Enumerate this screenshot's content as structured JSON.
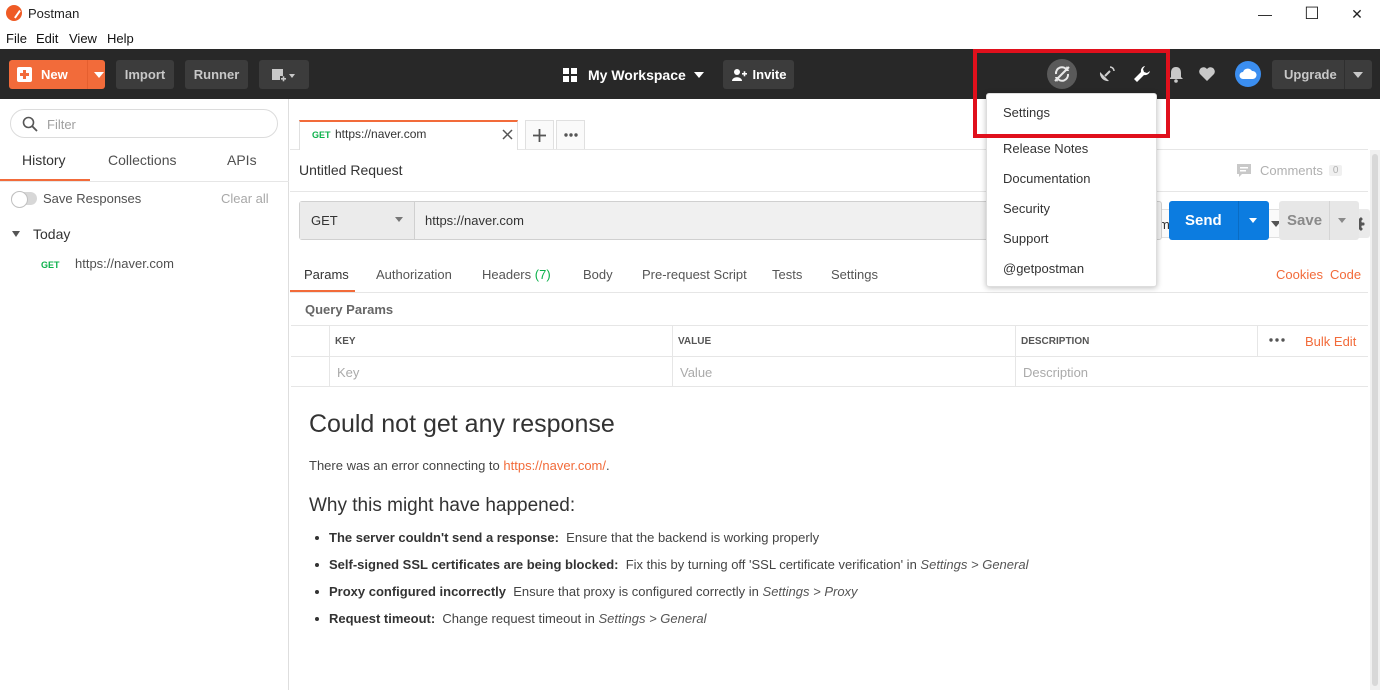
{
  "window": {
    "title": "Postman",
    "minimize": "—",
    "maximize": "☐",
    "close": "✕"
  },
  "menubar": [
    "File",
    "Edit",
    "View",
    "Help"
  ],
  "header": {
    "new_label": "New",
    "import_label": "Import",
    "runner_label": "Runner",
    "workspace_label": "My Workspace",
    "invite_label": "Invite",
    "upgrade_label": "Upgrade"
  },
  "sidebar": {
    "filter_placeholder": "Filter",
    "tabs": [
      "History",
      "Collections",
      "APIs"
    ],
    "active_tab": "History",
    "save_responses_label": "Save Responses",
    "clear_all_label": "Clear all",
    "group_label": "Today",
    "items": [
      {
        "method": "GET",
        "url": "https://naver.com"
      }
    ]
  },
  "request_tab": {
    "method": "GET",
    "url": "https://naver.com"
  },
  "request": {
    "name": "Untitled Request",
    "comments_label": "Comments",
    "comments_count": "0",
    "method": "GET",
    "url": "https://naver.com",
    "send_label": "Send",
    "save_label": "Save",
    "environment_fragment": "ment"
  },
  "request_tabs": {
    "params": "Params",
    "authorization": "Authorization",
    "headers": "Headers",
    "headers_count": "(7)",
    "body": "Body",
    "prerequest": "Pre-request Script",
    "tests": "Tests",
    "settings": "Settings",
    "cookies": "Cookies",
    "code": "Code"
  },
  "query_params": {
    "title": "Query Params",
    "columns": [
      "KEY",
      "VALUE",
      "DESCRIPTION"
    ],
    "placeholders": [
      "Key",
      "Value",
      "Description"
    ],
    "bulk_edit_label": "Bulk Edit"
  },
  "response": {
    "title": "Could not get any response",
    "error_prefix": "There was an error connecting to ",
    "error_link": "https://naver.com/",
    "error_suffix": ".",
    "why_title": "Why this might have happened:",
    "reasons": [
      {
        "bold": "The server couldn't send a response:",
        "text": "Ensure that the backend is working properly",
        "italic": ""
      },
      {
        "bold": "Self-signed SSL certificates are being blocked:",
        "text": "Fix this by turning off 'SSL certificate verification' in",
        "italic": "Settings > General"
      },
      {
        "bold": "Proxy configured incorrectly",
        "text": "Ensure that proxy is configured correctly in",
        "italic": "Settings > Proxy"
      },
      {
        "bold": "Request timeout:",
        "text": "Change request timeout in",
        "italic": "Settings > General"
      }
    ]
  },
  "settings_dropdown": {
    "items": [
      "Settings",
      "Release Notes",
      "Documentation",
      "Security",
      "Support",
      "@getpostman"
    ]
  },
  "colors": {
    "accent": "#f26b3a",
    "header_bg": "#282828",
    "send_blue": "#0c7ce0",
    "get_green": "#0cb14b",
    "highlight_red": "#e0101c"
  },
  "icons": {
    "sync": "sync-off-icon",
    "satellite": "satellite-icon",
    "wrench": "wrench-icon",
    "bell": "bell-icon",
    "heart": "heart-icon",
    "cloud": "cloud-icon",
    "eye": "eye-icon",
    "gear": "gear-icon"
  }
}
